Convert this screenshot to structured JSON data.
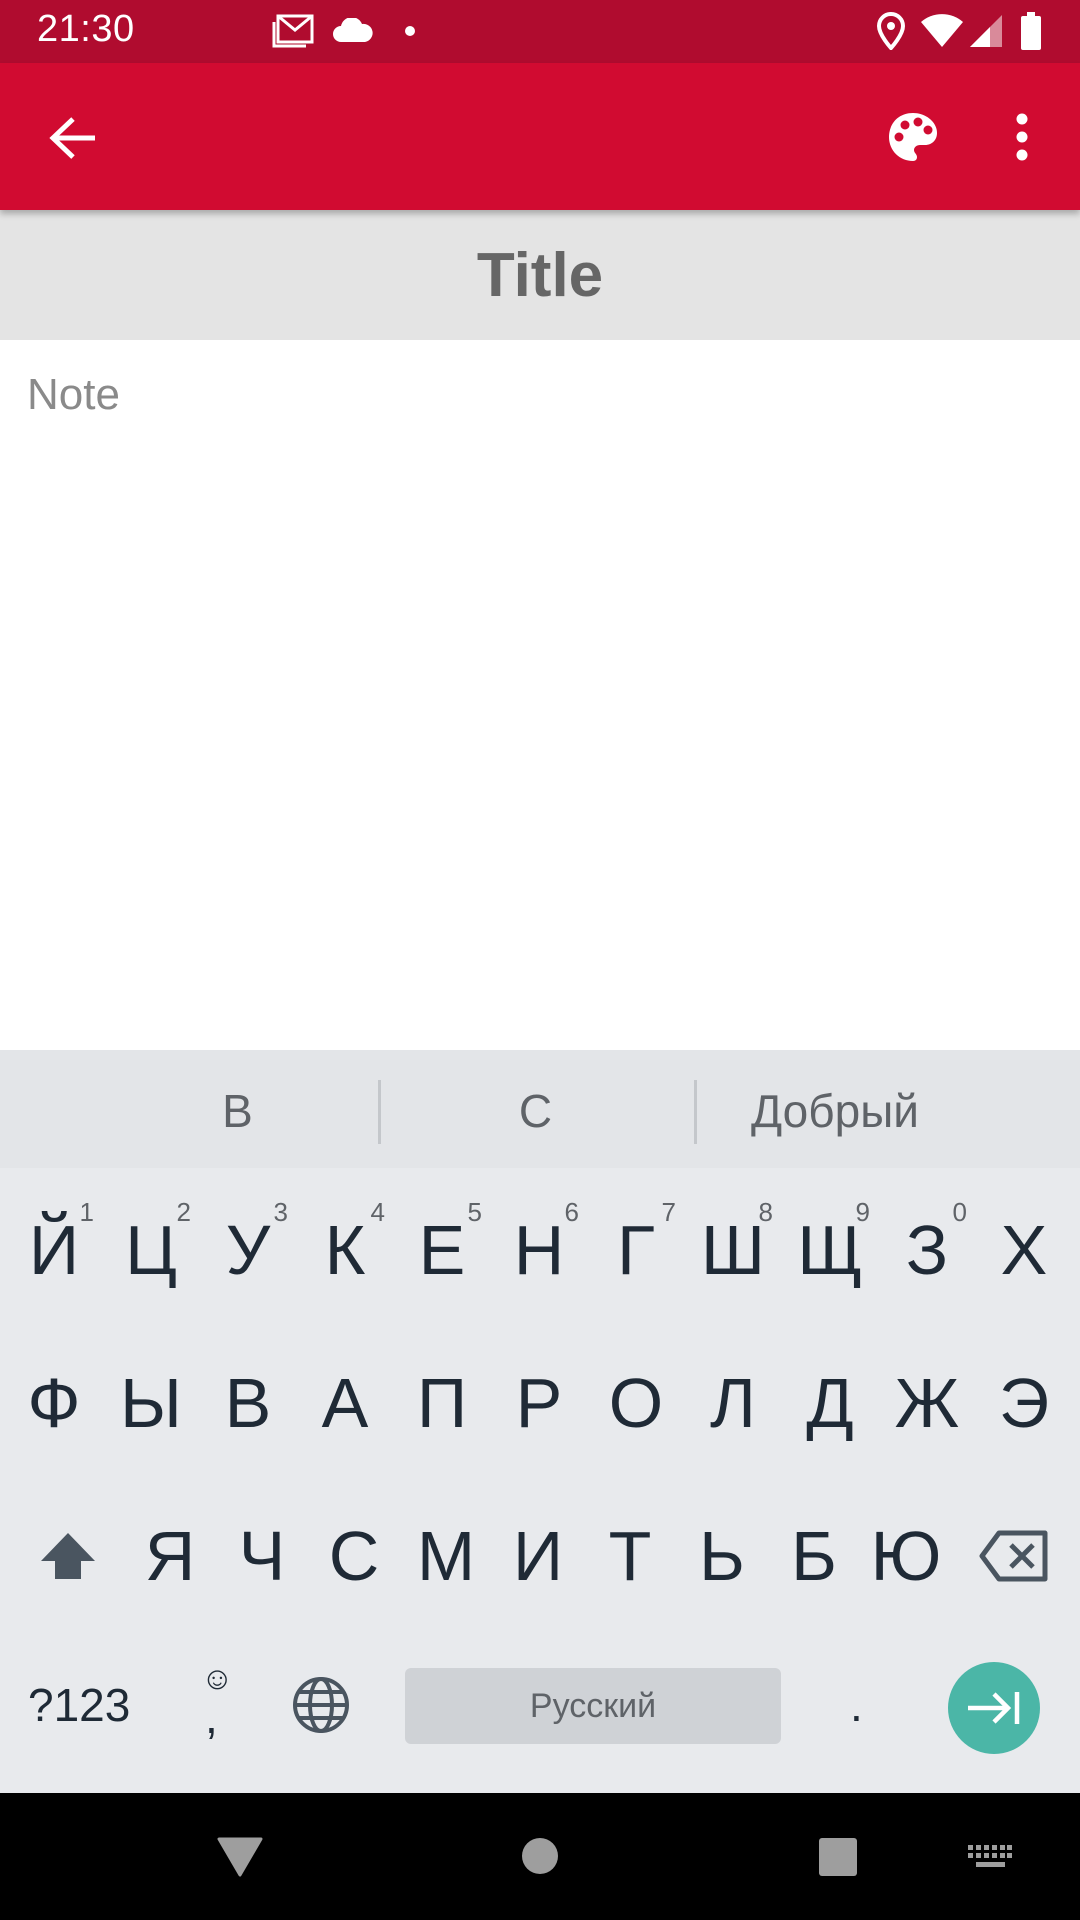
{
  "status_bar": {
    "time": "21:30",
    "icons": [
      "gmail-icon",
      "cloud-icon",
      "dot-icon",
      "location-icon",
      "wifi-icon",
      "signal-icon",
      "battery-icon"
    ]
  },
  "app_bar": {
    "back_icon": "arrow-back-icon",
    "palette_icon": "palette-icon",
    "more_icon": "more-vert-icon",
    "background": "#d10b31"
  },
  "editor": {
    "title_placeholder": "Title",
    "note_placeholder": "Note"
  },
  "keyboard": {
    "suggestions": [
      "В",
      "С",
      "Добрый"
    ],
    "row1": [
      {
        "label": "Й",
        "hint": "1"
      },
      {
        "label": "Ц",
        "hint": "2"
      },
      {
        "label": "У",
        "hint": "3"
      },
      {
        "label": "К",
        "hint": "4"
      },
      {
        "label": "Е",
        "hint": "5"
      },
      {
        "label": "Н",
        "hint": "6"
      },
      {
        "label": "Г",
        "hint": "7"
      },
      {
        "label": "Ш",
        "hint": "8"
      },
      {
        "label": "Щ",
        "hint": "9"
      },
      {
        "label": "З",
        "hint": "0"
      },
      {
        "label": "Х",
        "hint": ""
      }
    ],
    "row2": [
      "Ф",
      "Ы",
      "В",
      "А",
      "П",
      "Р",
      "О",
      "Л",
      "Д",
      "Ж",
      "Э"
    ],
    "row3": [
      "Я",
      "Ч",
      "С",
      "М",
      "И",
      "Т",
      "Ь",
      "Б",
      "Ю"
    ],
    "symbols_label": "?123",
    "emoji_hint": "☺",
    "comma_label": ",",
    "space_label": "Русский",
    "period_label": ".",
    "accent_color": "#4bb6a7"
  },
  "nav_bar": {
    "buttons": [
      "back-triangle-icon",
      "home-circle-icon",
      "recents-square-icon",
      "keyboard-switch-icon"
    ]
  }
}
